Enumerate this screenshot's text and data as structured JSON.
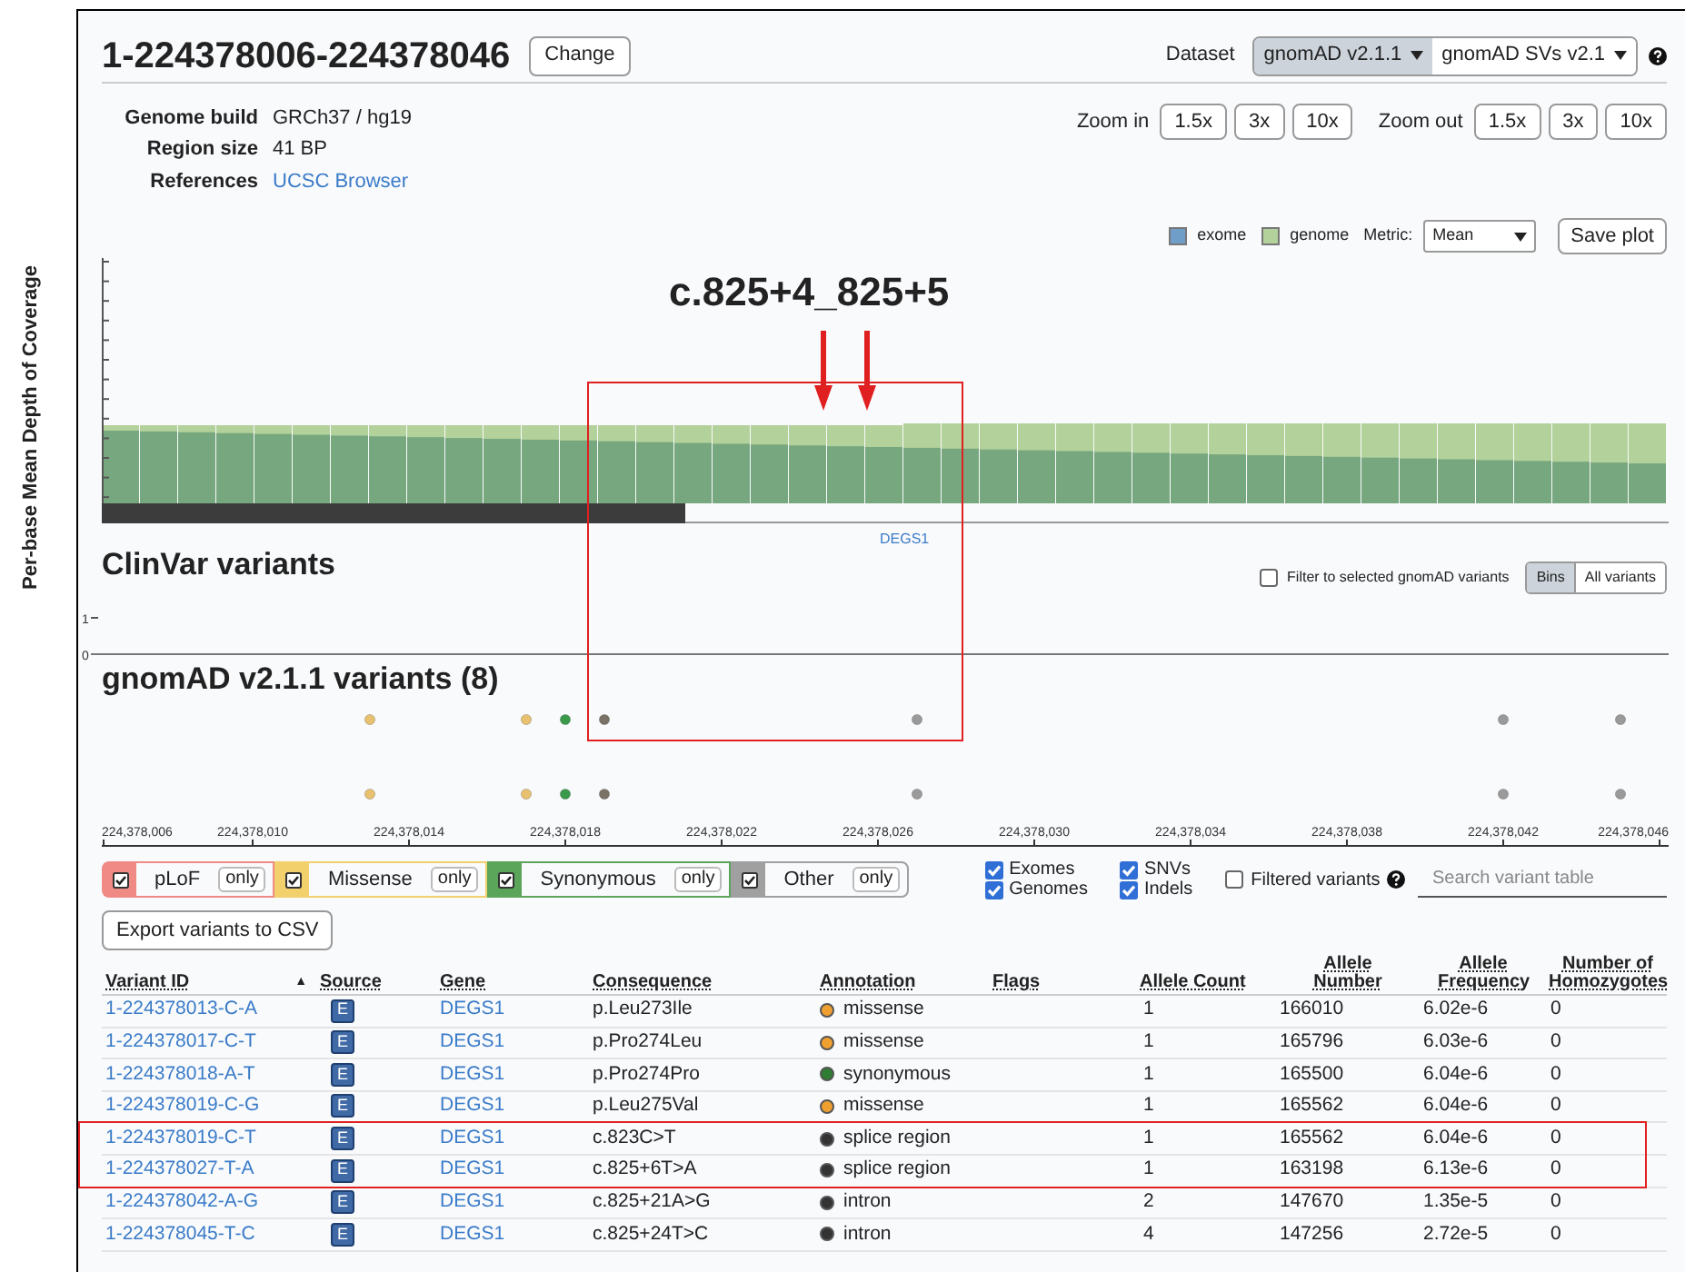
{
  "title": "1-224378006-224378046",
  "change_button": "Change",
  "dataset": {
    "label": "Dataset",
    "options": [
      {
        "label": "gnomAD v2.1.1",
        "selected": true
      },
      {
        "label": "gnomAD SVs v2.1",
        "selected": false
      }
    ]
  },
  "info": [
    {
      "label": "Genome build",
      "value": "GRCh37 / hg19",
      "kind": "text"
    },
    {
      "label": "Region size",
      "value": "41 BP",
      "kind": "text"
    },
    {
      "label": "References",
      "value": "UCSC Browser",
      "kind": "link"
    }
  ],
  "zoom_in": {
    "label": "Zoom in",
    "buttons": [
      "1.5x",
      "3x",
      "10x"
    ]
  },
  "zoom_out": {
    "label": "Zoom out",
    "buttons": [
      "1.5x",
      "3x",
      "10x"
    ]
  },
  "coverage": {
    "axis_label": "Per-base Mean Depth of Coverage",
    "legend": [
      {
        "label": "exome",
        "color": "#6f9fc9"
      },
      {
        "label": "genome",
        "color": "#b3d19a"
      }
    ],
    "metric_label": "Metric:",
    "metric_value": "Mean",
    "save_button": "Save plot"
  },
  "annotation": {
    "label": "c.825+4_825+5"
  },
  "gene_label": "DEGS1",
  "clinvar": {
    "title": "ClinVar variants",
    "filter_label": "Filter to selected gnomAD variants",
    "filter_checked": false,
    "view_buttons": [
      {
        "label": "Bins",
        "selected": true
      },
      {
        "label": "All variants",
        "selected": false
      }
    ],
    "y_ticks": [
      "1",
      "0"
    ]
  },
  "gnomad_track": {
    "title": "gnomAD v2.1.1 variants (8)",
    "axis_labels": [
      "224,378,006",
      "224,378,010",
      "224,378,014",
      "224,378,018",
      "224,378,022",
      "224,378,026",
      "224,378,030",
      "224,378,034",
      "224,378,038",
      "224,378,042",
      "224,378,046"
    ]
  },
  "filters": {
    "categories": [
      {
        "label": "pLoF",
        "checked": true,
        "color": "#f08a84",
        "only_label": "only"
      },
      {
        "label": "Missense",
        "checked": true,
        "color": "#f2d06b",
        "only_label": "only"
      },
      {
        "label": "Synonymous",
        "checked": true,
        "color": "#5aa55a",
        "only_label": "only"
      },
      {
        "label": "Other",
        "checked": true,
        "color": "#a0a0a0",
        "only_label": "only"
      }
    ],
    "sequencing": [
      {
        "label": "Exomes",
        "checked": true
      },
      {
        "label": "Genomes",
        "checked": true
      }
    ],
    "variant_types": [
      {
        "label": "SNVs",
        "checked": true
      },
      {
        "label": "Indels",
        "checked": true
      }
    ],
    "filtered_variants": {
      "label": "Filtered variants",
      "checked": false
    },
    "search_placeholder": "Search variant table"
  },
  "export_button": "Export variants to CSV",
  "table": {
    "columns": [
      "Variant ID",
      "Source",
      "Gene",
      "Consequence",
      "Annotation",
      "Flags",
      "Allele Count",
      "Allele Number",
      "Allele Frequency",
      "Number of Homozygotes"
    ],
    "sort_indicator": "▲",
    "rows": [
      {
        "variant_id": "1-224378013-C-A",
        "source": "E",
        "gene": "DEGS1",
        "consequence": "p.Leu273Ile",
        "annotation": "missense",
        "color": "#f0a030",
        "allele_count": "1",
        "allele_number": "166010",
        "allele_frequency": "6.02e-6",
        "homozygotes": "0"
      },
      {
        "variant_id": "1-224378017-C-T",
        "source": "E",
        "gene": "DEGS1",
        "consequence": "p.Pro274Leu",
        "annotation": "missense",
        "color": "#f0a030",
        "allele_count": "1",
        "allele_number": "165796",
        "allele_frequency": "6.03e-6",
        "homozygotes": "0"
      },
      {
        "variant_id": "1-224378018-A-T",
        "source": "E",
        "gene": "DEGS1",
        "consequence": "p.Pro274Pro",
        "annotation": "synonymous",
        "color": "#2e7d32",
        "allele_count": "1",
        "allele_number": "165500",
        "allele_frequency": "6.04e-6",
        "homozygotes": "0"
      },
      {
        "variant_id": "1-224378019-C-G",
        "source": "E",
        "gene": "DEGS1",
        "consequence": "p.Leu275Val",
        "annotation": "missense",
        "color": "#f0a030",
        "allele_count": "1",
        "allele_number": "165562",
        "allele_frequency": "6.04e-6",
        "homozygotes": "0"
      },
      {
        "variant_id": "1-224378019-C-T",
        "source": "E",
        "gene": "DEGS1",
        "consequence": "c.823C>T",
        "annotation": "splice region",
        "color": "#333333",
        "allele_count": "1",
        "allele_number": "165562",
        "allele_frequency": "6.04e-6",
        "homozygotes": "0"
      },
      {
        "variant_id": "1-224378027-T-A",
        "source": "E",
        "gene": "DEGS1",
        "consequence": "c.825+6T>A",
        "annotation": "splice region",
        "color": "#333333",
        "allele_count": "1",
        "allele_number": "163198",
        "allele_frequency": "6.13e-6",
        "homozygotes": "0"
      },
      {
        "variant_id": "1-224378042-A-G",
        "source": "E",
        "gene": "DEGS1",
        "consequence": "c.825+21A>G",
        "annotation": "intron",
        "color": "#333333",
        "allele_count": "2",
        "allele_number": "147670",
        "allele_frequency": "1.35e-5",
        "homozygotes": "0"
      },
      {
        "variant_id": "1-224378045-T-C",
        "source": "E",
        "gene": "DEGS1",
        "consequence": "c.825+24T>C",
        "annotation": "intron",
        "color": "#333333",
        "allele_count": "4",
        "allele_number": "147256",
        "allele_frequency": "2.72e-5",
        "homozygotes": "0"
      }
    ]
  }
}
